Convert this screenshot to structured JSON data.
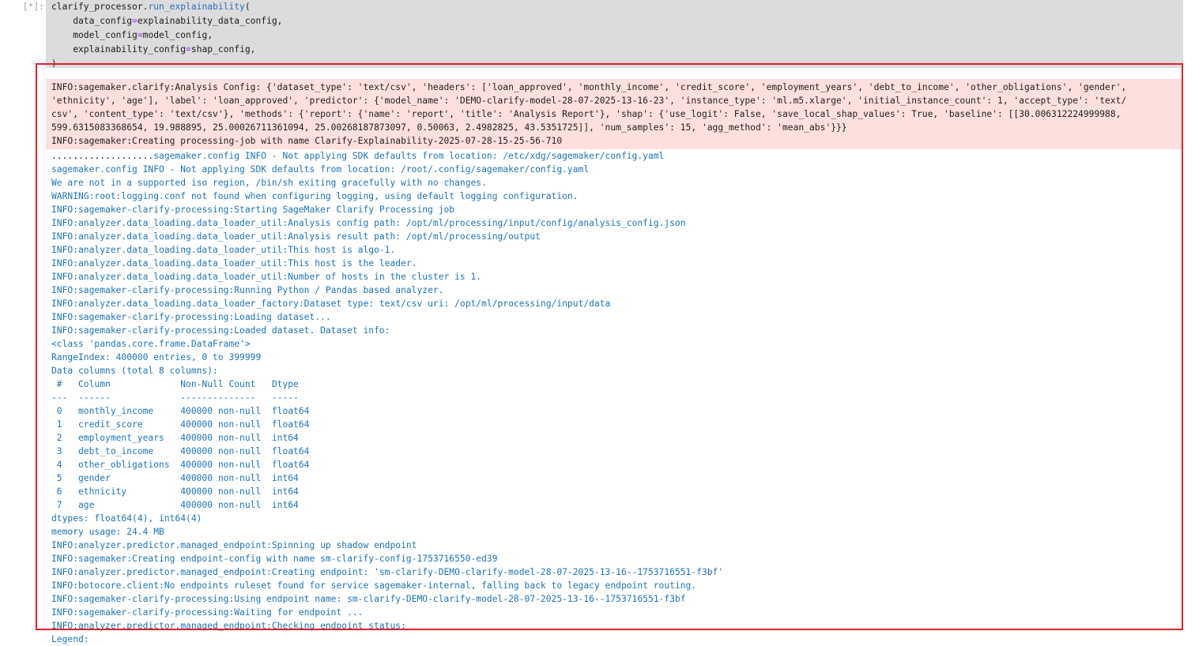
{
  "prompt": "[*]:",
  "input": {
    "line1_obj": "clarify_processor.",
    "line1_fn": "run_explainability",
    "line1_paren": "(",
    "args": [
      {
        "key": "    data_config",
        "value": "explainability_data_config,"
      },
      {
        "key": "    model_config",
        "value": "model_config,"
      },
      {
        "key": "    explainability_config",
        "value": "shap_config,"
      }
    ],
    "close": ")"
  },
  "stderr_lines": [
    "INFO:sagemaker.clarify:Analysis Config: {'dataset_type': 'text/csv', 'headers': ['loan_approved', 'monthly_income', 'credit_score', 'employment_years', 'debt_to_income', 'other_obligations', 'gender',",
    "'ethnicity', 'age'], 'label': 'loan_approved', 'predictor': {'model_name': 'DEMO-clarify-model-28-07-2025-13-16-23', 'instance_type': 'ml.m5.xlarge', 'initial_instance_count': 1, 'accept_type': 'text/",
    "csv', 'content_type': 'text/csv'}, 'methods': {'report': {'name': 'report', 'title': 'Analysis Report'}, 'shap': {'use_logit': False, 'save_local_shap_values': True, 'baseline': [[30.006312224999988,",
    "599.6315083368654, 19.988895, 25.00026711361094, 25.00268187873097, 0.50063, 2.4982825, 43.5351725]], 'num_samples': 15, 'agg_method': 'mean_abs'}}}",
    "INFO:sagemaker:Creating processing-job with name Clarify-Explainability-2025-07-28-15-25-56-710"
  ],
  "stdout_first_dots": "...................",
  "stdout_first_rest": "sagemaker.config INFO - Not applying SDK defaults from location: /etc/xdg/sagemaker/config.yaml",
  "stdout_lines": [
    "sagemaker.config INFO - Not applying SDK defaults from location: /root/.config/sagemaker/config.yaml",
    "We are not in a supported iso region, /bin/sh exiting gracefully with no changes.",
    "WARNING:root:logging.conf not found when configuring logging, using default logging configuration.",
    "INFO:sagemaker-clarify-processing:Starting SageMaker Clarify Processing job",
    "INFO:analyzer.data_loading.data_loader_util:Analysis config path: /opt/ml/processing/input/config/analysis_config.json",
    "INFO:analyzer.data_loading.data_loader_util:Analysis result path: /opt/ml/processing/output",
    "INFO:analyzer.data_loading.data_loader_util:This host is algo-1.",
    "INFO:analyzer.data_loading.data_loader_util:This host is the leader.",
    "INFO:analyzer.data_loading.data_loader_util:Number of hosts in the cluster is 1.",
    "INFO:sagemaker-clarify-processing:Running Python / Pandas based analyzer.",
    "INFO:analyzer.data_loading.data_loader_factory:Dataset type: text/csv uri: /opt/ml/processing/input/data",
    "INFO:sagemaker-clarify-processing:Loading dataset...",
    "INFO:sagemaker-clarify-processing:Loaded dataset. Dataset info:",
    "<class 'pandas.core.frame.DataFrame'>",
    "RangeIndex: 400000 entries, 0 to 399999",
    "Data columns (total 8 columns):",
    " #   Column             Non-Null Count   Dtype  ",
    "---  ------             --------------   -----  ",
    " 0   monthly_income     400000 non-null  float64",
    " 1   credit_score       400000 non-null  float64",
    " 2   employment_years   400000 non-null  int64  ",
    " 3   debt_to_income     400000 non-null  float64",
    " 4   other_obligations  400000 non-null  float64",
    " 5   gender             400000 non-null  int64  ",
    " 6   ethnicity          400000 non-null  int64  ",
    " 7   age                400000 non-null  int64  ",
    "dtypes: float64(4), int64(4)",
    "memory usage: 24.4 MB",
    "INFO:analyzer.predictor.managed_endpoint:Spinning up shadow endpoint",
    "INFO:sagemaker:Creating endpoint-config with name sm-clarify-config-1753716550-ed39",
    "INFO:analyzer.predictor.managed_endpoint:Creating endpoint: 'sm-clarify-DEMO-clarify-model-28-07-2025-13-16--1753716551-f3bf'",
    "INFO:botocore.client:No endpoints ruleset found for service sagemaker-internal, falling back to legacy endpoint routing.",
    "INFO:sagemaker-clarify-processing:Using endpoint name: sm-clarify-DEMO-clarify-model-28-07-2025-13-16--1753716551-f3bf",
    "INFO:sagemaker-clarify-processing:Waiting for endpoint ...",
    "INFO:analyzer.predictor.managed_endpoint:Checking endpoint status:",
    "Legend:"
  ],
  "colors": {
    "highlight_border": "#e0202a",
    "stderr_bg": "#fddfdd",
    "stdout_text": "#1f73b7",
    "input_bg": "#dcdcdc"
  }
}
